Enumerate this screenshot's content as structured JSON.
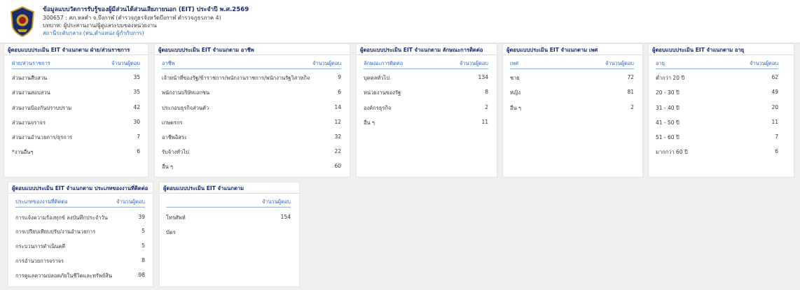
{
  "header": {
    "title": "ข้อมูลแบบวัดการรับรู้ของผู้มีส่วนได้ส่วนเสียภายนอก (EIT) ประจำปี พ.ศ.2569",
    "org": "300657 : สภ.หลคำ จ.บึงกาฬ (ตำรวจภูธรจังหวัดบึงกาฬ ตำรวจภูธรภาค 4)",
    "role": "บทบาท: ผู้ประสานงาน/ผู้ดูแลระบบของหน่วยงาน",
    "link": "สถานีระดับกลาง (หน.ตำแหน่ง ผู้กำกับการ)",
    "logo_icon": "police-badge-icon"
  },
  "colors": {
    "title": "#1b2a6b",
    "accent": "#2a66c9",
    "rule": "#8fb0e3"
  },
  "cards": {
    "dept": {
      "title": "ผู้ตอบแบบประเมิน EIT จำแนกตาม ฝ่าย/ส่วนราชการ",
      "col_label": "ฝ่าย/ส่วนราชการ",
      "col_value": "จำนวนผู้ตอบ",
      "rows": [
        {
          "label": "ส่วนงานสืบสวน",
          "value": "35"
        },
        {
          "label": "ส่วนงานสอบสวน",
          "value": "35"
        },
        {
          "label": "ส่วนงานป้องกันปราบปราม",
          "value": "42"
        },
        {
          "label": "ส่วนงานจราจร",
          "value": "30"
        },
        {
          "label": "ส่วนงานอำนวยการ/ธุรการ",
          "value": "7"
        },
        {
          "label": "*งานอื่นๆ",
          "value": "6"
        }
      ]
    },
    "occupation": {
      "title": "ผู้ตอบแบบประเมิน EIT จำแนกตาม อาชีพ",
      "col_label": "อาชีพ",
      "col_value": "จำนวนผู้ตอบ",
      "rows": [
        {
          "label": "เจ้าหน้าที่ของรัฐ/ข้าราชการ/พนักงานราชการ/พนักงานรัฐวิสาหกิจ",
          "value": "9"
        },
        {
          "label": "พนักงานบริษัทเอกชน",
          "value": "6"
        },
        {
          "label": "ประกอบธุรกิจส่วนตัว",
          "value": "14"
        },
        {
          "label": "เกษตรกร",
          "value": "12"
        },
        {
          "label": "อาชีพอิสระ",
          "value": "32"
        },
        {
          "label": "รับจ้างทั่วไป",
          "value": "22"
        },
        {
          "label": "อื่น ๆ",
          "value": "60"
        }
      ]
    },
    "contact": {
      "title": "ผู้ตอบแบบประเมิน EIT จำแนกตาม ลักษณะการติดต่อ",
      "col_label": "ลักษณะการติดต่อ",
      "col_value": "จำนวนผู้ตอบ",
      "rows": [
        {
          "label": "บุคคลทั่วไป",
          "value": "134"
        },
        {
          "label": "หน่วยงานของรัฐ",
          "value": "8"
        },
        {
          "label": "องค์กรธุรกิจ",
          "value": "2"
        },
        {
          "label": "อื่น ๆ",
          "value": "11"
        }
      ]
    },
    "gender": {
      "title": "ผู้ตอบแบบประเมิน EIT จำแนกตาม เพศ",
      "col_label": "เพศ",
      "col_value": "จำนวนผู้ตอบ",
      "rows": [
        {
          "label": "ชาย",
          "value": "72"
        },
        {
          "label": "หญิง",
          "value": "81"
        },
        {
          "label": "อื่น ๆ",
          "value": "2"
        }
      ]
    },
    "age": {
      "title": "ผู้ตอบแบบประเมิน EIT จำแนกตาม อายุ",
      "col_label": "อายุ",
      "col_value": "จำนวนผู้ตอบ",
      "rows": [
        {
          "label": "ต่ำกว่า 20 ปี",
          "value": "62"
        },
        {
          "label": "20 - 30 ปี",
          "value": "49"
        },
        {
          "label": "31 - 40 ปี",
          "value": "20"
        },
        {
          "label": "41 - 50 ปี",
          "value": "11"
        },
        {
          "label": "51 - 60 ปี",
          "value": "7"
        },
        {
          "label": "มากกว่า 60 ปี",
          "value": "6"
        }
      ]
    },
    "worktype": {
      "title": "ผู้ตอบแบบประเมิน EIT จำแนกตาม ประเภทของงานที่ติดต่อ",
      "col_label": "ประเภทของงานที่ติดต่อ",
      "col_value": "จำนวนผู้ตอบ",
      "rows": [
        {
          "label": "การแจ้งความร้องทุกข์ ลงบันทึกประจำวัน",
          "value": "39"
        },
        {
          "label": "การเปรียบเทียบปรับ/งานอำนวยการ",
          "value": "5"
        },
        {
          "label": "กระบวนการดำเนินคดี",
          "value": "5"
        },
        {
          "label": "การอำนวยการจราจร",
          "value": "8"
        },
        {
          "label": "การดูแลความปลอดภัยในชีวิตและทรัพย์สิน",
          "value": "98"
        }
      ]
    },
    "channel": {
      "title": "ผู้ตอบแบบประเมิน EIT จำแนกตาม",
      "col_label": "",
      "col_value": "จำนวนผู้ตอบ",
      "rows": [
        {
          "label": "โทรศัพท์",
          "value": "154"
        },
        {
          "label": "บัตร",
          "value": ""
        }
      ]
    }
  }
}
